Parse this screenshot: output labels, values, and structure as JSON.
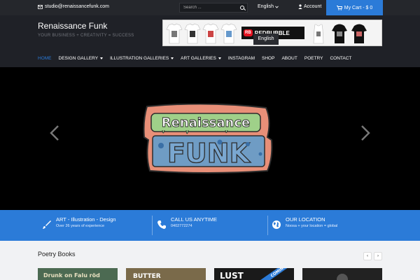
{
  "topbar": {
    "email": "studio@renaissancefunk.com",
    "search_placeholder": "Search ...",
    "language": "English",
    "account_label": "Account",
    "cart_label": "My Cart - $ 0"
  },
  "header": {
    "site_title": "Renaissance Funk",
    "tagline": "YOUR BUSINESS + CREATIVITY = SUCCESS",
    "banner_brand": "REDBUBBLE",
    "banner_brand_badge": "RB",
    "language_dropdown_option": "English"
  },
  "nav": [
    {
      "label": "HOME",
      "active": true,
      "caret": false
    },
    {
      "label": "DESIGN GALLERY",
      "active": false,
      "caret": true
    },
    {
      "label": "ILLUSTRATION GALLERIES",
      "active": false,
      "caret": true
    },
    {
      "label": "ART GALLERIES",
      "active": false,
      "caret": true
    },
    {
      "label": "INSTAGRAM",
      "active": false,
      "caret": false
    },
    {
      "label": "SHOP",
      "active": false,
      "caret": false
    },
    {
      "label": "ABOUT",
      "active": false,
      "caret": false
    },
    {
      "label": "POETRY",
      "active": false,
      "caret": false
    },
    {
      "label": "CONTACT",
      "active": false,
      "caret": false
    }
  ],
  "hero": {
    "logo_line1": "Renaissance",
    "logo_line2": "FUNK"
  },
  "features": [
    {
      "title": "ART - Illustration - Design",
      "subtitle": "Over 26 years of experience",
      "icon": "brush-icon"
    },
    {
      "title": "CALL US ANYTIME",
      "subtitle": "0402772274",
      "icon": "phone-icon"
    },
    {
      "title": "OUR LOCATION",
      "subtitle": "Noosa + your location = global",
      "icon": "globe-icon"
    }
  ],
  "books": {
    "title": "Poetry Books",
    "prev": "‹",
    "next": "›",
    "covers": [
      "Drunk on Falu röd",
      "BUTTER",
      "LUST",
      "COMING"
    ]
  },
  "colors": {
    "accent": "#2b7bd8",
    "topbar": "#25272c",
    "header": "#1f2127"
  }
}
